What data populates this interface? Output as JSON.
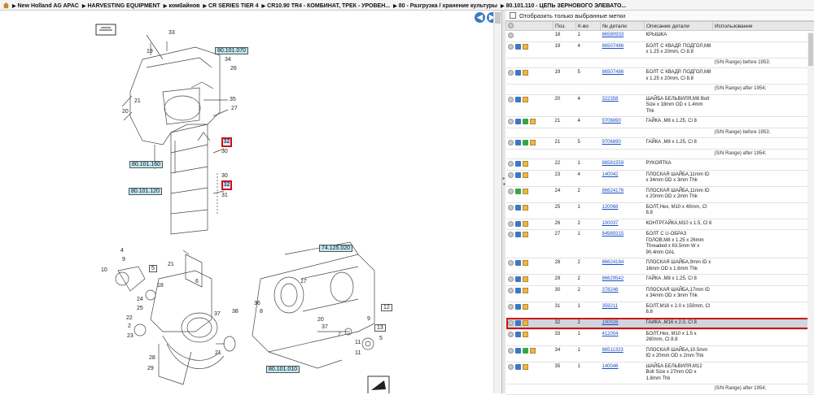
{
  "breadcrumbs": [
    "New Holland AG APAC",
    "HARVESTING EQUIPMENT",
    "комбайнов",
    "CR SERIES TIER 4",
    "CR10.90 TR4 - КОМБИНАТ, ТРЕК - УРОВЕН...",
    "80 - Разгрузка / хранение культуры",
    "80.101.110 - ЦЕПЬ ЗЕРНОВОГО ЭЛЕВАТО..."
  ],
  "diagram": {
    "nav_prev": "◀",
    "nav_next": "▶",
    "refs": [
      "80.101.070",
      "80.101.160",
      "80.101.120",
      "74.125.020",
      "80.101.010"
    ],
    "highlighted_callouts": [
      "32",
      "32"
    ],
    "callouts": [
      "33",
      "19",
      "34",
      "26",
      "35",
      "27",
      "21",
      "20",
      "30",
      "31",
      "30",
      "4",
      "9",
      "10",
      "5",
      "21",
      "18",
      "6",
      "24",
      "25",
      "37",
      "22",
      "2",
      "23",
      "28",
      "29",
      "17",
      "36",
      "8",
      "20",
      "37",
      "38",
      "21",
      "7",
      "11",
      "12",
      "13",
      "9",
      "11",
      "5"
    ]
  },
  "filter": {
    "label": "Отобразить только выбранные метки",
    "checked": false
  },
  "table": {
    "columns": [
      "Поз.",
      "К-во",
      "№ детали",
      "Описание детали",
      "Использование"
    ],
    "rows": [
      {
        "pos": "18",
        "qty": "1",
        "part": "86580933",
        "desc": "КРЫШКА",
        "usage": "",
        "icons": [
          "info"
        ]
      },
      {
        "pos": "19",
        "qty": "4",
        "part": "86507486",
        "desc": "БОЛТ С КВАДР. ПОДГОЛ,M8 x 1.25 x 20mm, Cl 8.8",
        "usage": "",
        "icons": [
          "info",
          "add",
          "box"
        ]
      },
      {
        "note": "(S/N Range) before 1953;"
      },
      {
        "pos": "19",
        "qty": "5",
        "part": "86507486",
        "desc": "БОЛТ С КВАДР. ПОДГОЛ,M8 x 1.25 x 20mm, Cl 8.8",
        "usage": "",
        "icons": [
          "info",
          "add",
          "box"
        ]
      },
      {
        "note": "(S/N Range) after 1954;"
      },
      {
        "pos": "20",
        "qty": "4",
        "part": "322358",
        "desc": "ШАЙБА БЕЛЬВИЛЯ,M8 Bolt Size x 18mm OD x 1.4mm Thk",
        "usage": "",
        "icons": [
          "info",
          "add",
          "box"
        ]
      },
      {
        "pos": "21",
        "qty": "4",
        "part": "9706690",
        "desc": "ГАЙКА ,M8 x 1.25, Cl 8",
        "usage": "",
        "icons": [
          "info",
          "add",
          "alt",
          "box"
        ]
      },
      {
        "note": "(S/N Range) before 1953;"
      },
      {
        "pos": "21",
        "qty": "5",
        "part": "9706690",
        "desc": "ГАЙКА ,M8 x 1.25, Cl 8",
        "usage": "",
        "icons": [
          "info",
          "add",
          "alt",
          "box"
        ]
      },
      {
        "note": "(S/N Range) after 1954;"
      },
      {
        "pos": "22",
        "qty": "1",
        "part": "86581559",
        "desc": "РУКОЯТКА",
        "usage": "",
        "icons": [
          "info",
          "add",
          "box"
        ]
      },
      {
        "pos": "23",
        "qty": "4",
        "part": "140042",
        "desc": "ПЛОСКАЯ ШАЙБА,11mm ID x 34mm OD x 3mm Thk",
        "usage": "",
        "icons": [
          "info",
          "add",
          "box"
        ]
      },
      {
        "pos": "24",
        "qty": "2",
        "part": "86624176",
        "desc": "ПЛОСКАЯ ШАЙБА,11mm ID x 20mm OD x 2mm Thk",
        "usage": "",
        "icons": [
          "info",
          "alt",
          "box"
        ]
      },
      {
        "pos": "25",
        "qty": "1",
        "part": "120068",
        "desc": "БОЛТ,Hex, M10 x 40mm, Cl 8.8",
        "usage": "",
        "icons": [
          "info",
          "add",
          "box"
        ]
      },
      {
        "pos": "26",
        "qty": "2",
        "part": "100037",
        "desc": "КОНТРГАЙКА,M10 x 1.5, Cl 8",
        "usage": "",
        "icons": [
          "info",
          "add",
          "box"
        ]
      },
      {
        "pos": "27",
        "qty": "1",
        "part": "84989315",
        "desc": "БОЛТ С U-ОБРАЗ ГОЛОВ,M8 x 1.25 x 26mm Threaded x 63.5mm W x 90.4mm OAL",
        "usage": "",
        "icons": [
          "info",
          "add",
          "box"
        ]
      },
      {
        "pos": "28",
        "qty": "2",
        "part": "86624184",
        "desc": "ПЛОСКАЯ ШАЙБА,9mm ID x 16mm OD x 1.6mm Thk",
        "usage": "",
        "icons": [
          "info",
          "add",
          "box"
        ]
      },
      {
        "pos": "29",
        "qty": "2",
        "part": "86629542",
        "desc": "ГАЙКА ,M8 x 1.25, Cl 8",
        "usage": "",
        "icons": [
          "info",
          "add",
          "box"
        ]
      },
      {
        "pos": "30",
        "qty": "2",
        "part": "378246",
        "desc": "ПЛОСКАЯ ШАЙБА,17mm ID x 34mm OD x 3mm Thk",
        "usage": "",
        "icons": [
          "info",
          "add",
          "box"
        ]
      },
      {
        "pos": "31",
        "qty": "1",
        "part": "359211",
        "desc": "БОЛТ,M16 x 2.0 x 150mm, Cl 8.8",
        "usage": "",
        "icons": [
          "info",
          "add",
          "box"
        ]
      },
      {
        "pos": "32",
        "qty": "2",
        "part": "100026",
        "desc": "ГАЙКА ,M16 x 2.0, Cl 8",
        "usage": "",
        "icons": [
          "info",
          "add",
          "box"
        ],
        "selected": true
      },
      {
        "pos": "33",
        "qty": "1",
        "part": "412004",
        "desc": "БОЛТ,Hex, M10 x 1.5 x 260mm, Cl 8.8",
        "usage": "",
        "icons": [
          "info",
          "add",
          "box"
        ]
      },
      {
        "pos": "34",
        "qty": "1",
        "part": "86511323",
        "desc": "ПЛОСКАЯ ШАЙБА,10.5mm ID x 20mm OD x 2mm Thk",
        "usage": "",
        "icons": [
          "info",
          "add",
          "alt",
          "box"
        ]
      },
      {
        "pos": "35",
        "qty": "1",
        "part": "140046",
        "desc": "ШАЙБА БЕЛЬВИЛЯ,M12 Bolt Size x 27mm OD x 1.8mm Thk",
        "usage": "",
        "icons": [
          "info",
          "add",
          "box"
        ]
      },
      {
        "note": "(S/N Range) after 1954;"
      }
    ]
  }
}
